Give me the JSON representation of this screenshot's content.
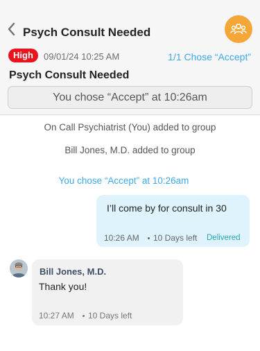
{
  "header": {
    "title": "Psych Consult Needed",
    "group_icon": "group-icon",
    "accent_color": "#f4a636"
  },
  "info": {
    "priority": "High",
    "priority_color": "#e8131d",
    "date": "09/01/24 10:25 AM",
    "chose_count": "1/1 Chose “Accept”",
    "subject": "Psych Consult Needed",
    "accept_status": "You chose “Accept” at 10:26am"
  },
  "system_messages": [
    "On Call Psychiatrist (You) added to group",
    "Bill Jones, M.D. added to group",
    "You chose “Accept” at 10:26am"
  ],
  "messages": {
    "outgoing": {
      "text": "I’ll come by for consult in 30",
      "time": "10:26 AM",
      "expires": "10 Days left",
      "status": "Delivered"
    },
    "incoming": {
      "sender": "Bill Jones, M.D.",
      "text": "Thank you!",
      "time": "10:27 AM",
      "expires": "10 Days left"
    }
  }
}
